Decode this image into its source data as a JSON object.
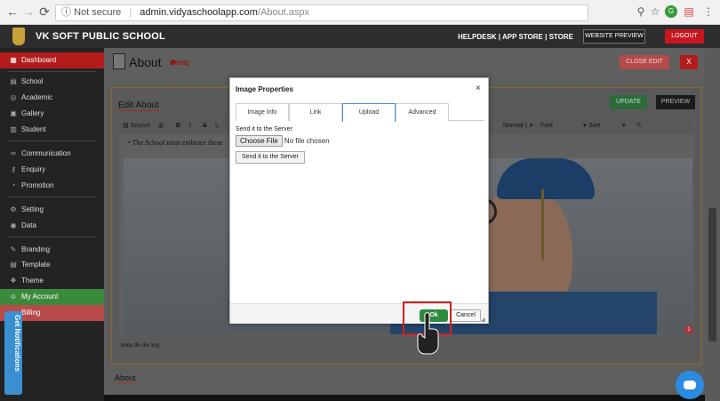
{
  "browser": {
    "back": "←",
    "forward": "→",
    "reload": "⟳",
    "security": "Not secure",
    "url_host": "admin.vidyaschoolapp.com",
    "url_path": "/About.aspx",
    "icons": [
      "search-icon",
      "star-icon",
      "extension-icon",
      "menu-icon"
    ]
  },
  "header": {
    "school_name": "VK SOFT PUBLIC SCHOOL",
    "top_links": "HELPDESK | APP STORE | STORE",
    "website_preview": "WEBSITE PREVIEW",
    "logout": "LOGOUT"
  },
  "sidebar": {
    "items": [
      {
        "label": "Dashboard",
        "icon": "grid-icon",
        "glyph": "▦"
      },
      {
        "label": "School",
        "icon": "school-icon",
        "glyph": "▤"
      },
      {
        "label": "Academic",
        "icon": "globe-icon",
        "glyph": "◎"
      },
      {
        "label": "Gallery",
        "icon": "image-icon",
        "glyph": "▣"
      },
      {
        "label": "Student",
        "icon": "student-icon",
        "glyph": "▥"
      },
      {
        "label": "Communication",
        "icon": "link-icon",
        "glyph": "∞"
      },
      {
        "label": "Enquiry",
        "icon": "key-icon",
        "glyph": "⚷"
      },
      {
        "label": "Promotion",
        "icon": "promotion-icon",
        "glyph": "◔"
      },
      {
        "label": "Setting",
        "icon": "gear-icon",
        "glyph": "⚙"
      },
      {
        "label": "Data",
        "icon": "data-icon",
        "glyph": "◉"
      },
      {
        "label": "Branding",
        "icon": "brush-icon",
        "glyph": "✎"
      },
      {
        "label": "Template",
        "icon": "template-icon",
        "glyph": "▤"
      },
      {
        "label": "Theme",
        "icon": "theme-icon",
        "glyph": "❖"
      },
      {
        "label": "My Account",
        "icon": "account-icon",
        "glyph": "☺"
      },
      {
        "label": "Billing",
        "icon": "billing-icon",
        "glyph": "▭"
      }
    ]
  },
  "main": {
    "title": "About",
    "help": "❶help",
    "close_edit": "CLOSE EDIT",
    "close_x": "X",
    "edit_about": "Edit About",
    "update": "UPDATE",
    "preview": "PREVIEW",
    "toolbar": {
      "source": "Source",
      "bold": "B",
      "italic": "I",
      "strike": "S",
      "clear": "Iₓ",
      "format": "Normal (...",
      "font": "Font",
      "size": "Size"
    },
    "editor_text": "The School must embrace these",
    "pathbar": "body  div  div  img",
    "badge": "1",
    "about_label": "About"
  },
  "dialog": {
    "title": "Image Properties",
    "close": "×",
    "tabs": [
      "Image Info",
      "Link",
      "Upload",
      "Advanced"
    ],
    "active_tab": "Upload",
    "send_label": "Send it to the Server",
    "choose_file": "Choose File",
    "no_file": "No file chosen",
    "send_button": "Send it to the Server",
    "ok": "Ok",
    "cancel": "Cancel"
  },
  "notifications": {
    "label": "Get Notifications"
  },
  "colors": {
    "accent_red": "#b41c1c",
    "accent_green": "#2d8a3e",
    "notif_blue": "#3a8fd1"
  }
}
